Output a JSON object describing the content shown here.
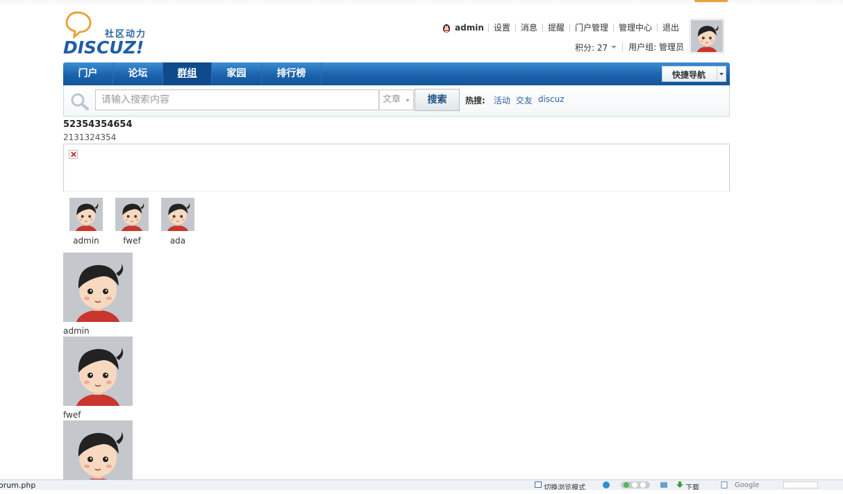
{
  "header": {
    "logo_sub": "社区动力",
    "logo_word": "DISCUZ!",
    "username": "admin",
    "links": [
      "设置",
      "消息",
      "提醒",
      "门户管理",
      "管理中心",
      "退出"
    ],
    "credits": "积分: 27",
    "usergroup": "用户组: 管理员"
  },
  "nav": {
    "items": [
      "门户",
      "论坛",
      "群组",
      "家园",
      "排行榜"
    ],
    "active_index": 2,
    "quick_nav": "快捷导航"
  },
  "search": {
    "placeholder": "请输入搜索内容",
    "type": "文章",
    "button": "搜索",
    "hot_label": "热搜:",
    "hot_keywords": [
      "活动",
      "交友",
      "discuz"
    ]
  },
  "group": {
    "title": "52354354654",
    "description": "2131324354"
  },
  "members_small": [
    {
      "name": "admin"
    },
    {
      "name": "fwef"
    },
    {
      "name": "ada"
    }
  ],
  "members_large": [
    {
      "name": "admin"
    },
    {
      "name": "fwef"
    },
    {
      "name": ""
    }
  ],
  "statusbar": {
    "url": "orum.php",
    "switch_mode": "切换浏览模式",
    "download": "下载",
    "search_engine": "Google"
  },
  "colors": {
    "nav_bg": "#1b62ad",
    "link": "#2a5ea3",
    "accent_orange": "#e8a23a"
  }
}
